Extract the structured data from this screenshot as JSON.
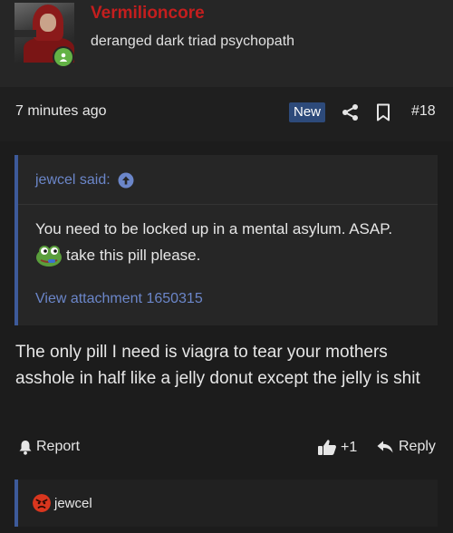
{
  "user": {
    "name": "Vermilioncore",
    "title": "deranged dark triad psychopath"
  },
  "meta": {
    "time_ago": "7 minutes ago",
    "new_label": "New",
    "post_number": "#18"
  },
  "quote": {
    "author_label": "jewcel said:",
    "line1": "You need to be locked up in a mental asylum. ASAP.",
    "line2": "take this pill please.",
    "attachment_link": "View attachment 1650315"
  },
  "reply_body": "The only pill I need is viagra to tear your mothers asshole in half like a jelly donut except the jelly is shit",
  "actions": {
    "report_label": "Report",
    "like_count": "+1",
    "reply_label": "Reply"
  },
  "reactions": {
    "reactor": "jewcel"
  },
  "colors": {
    "username": "#c41e1e",
    "link": "#6b86c9",
    "accent_border": "#3d5a9a",
    "online": "#63b245",
    "angry": "#d9361e"
  }
}
